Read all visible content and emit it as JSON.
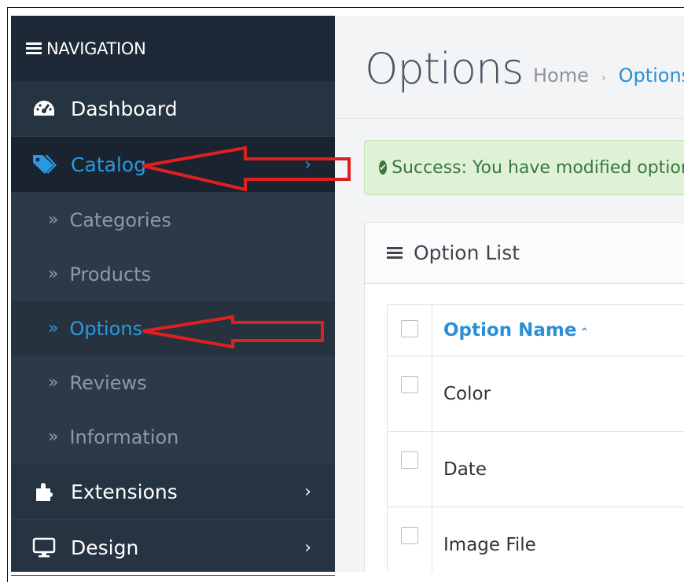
{
  "sidebar": {
    "header": "NAVIGATION",
    "items": [
      {
        "label": "Dashboard",
        "icon": "dashboard-icon"
      },
      {
        "label": "Catalog",
        "icon": "tags-icon",
        "chevron": "›"
      },
      {
        "label": "Extensions",
        "icon": "puzzle-icon",
        "chevron": "›"
      },
      {
        "label": "Design",
        "icon": "monitor-icon",
        "chevron": "›"
      }
    ],
    "catalog_sub": [
      {
        "label": "Categories"
      },
      {
        "label": "Products"
      },
      {
        "label": "Options"
      },
      {
        "label": "Reviews"
      },
      {
        "label": "Information"
      }
    ],
    "sub_marker": "»"
  },
  "page": {
    "title": "Options",
    "breadcrumb": {
      "home": "Home",
      "sep": "›",
      "current": "Options"
    }
  },
  "alert": {
    "text": "Success: You have modified options!"
  },
  "panel": {
    "title": "Option List"
  },
  "table": {
    "header": {
      "name": "Option Name",
      "sort": "⌃"
    },
    "rows": [
      {
        "name": "Color"
      },
      {
        "name": "Date"
      },
      {
        "name": "Image File"
      }
    ]
  },
  "colors": {
    "sidebar_bg": "#263340",
    "accent_blue": "#2a98e0",
    "alert_green": "#dff2d8",
    "annotation_red": "#e02020"
  }
}
